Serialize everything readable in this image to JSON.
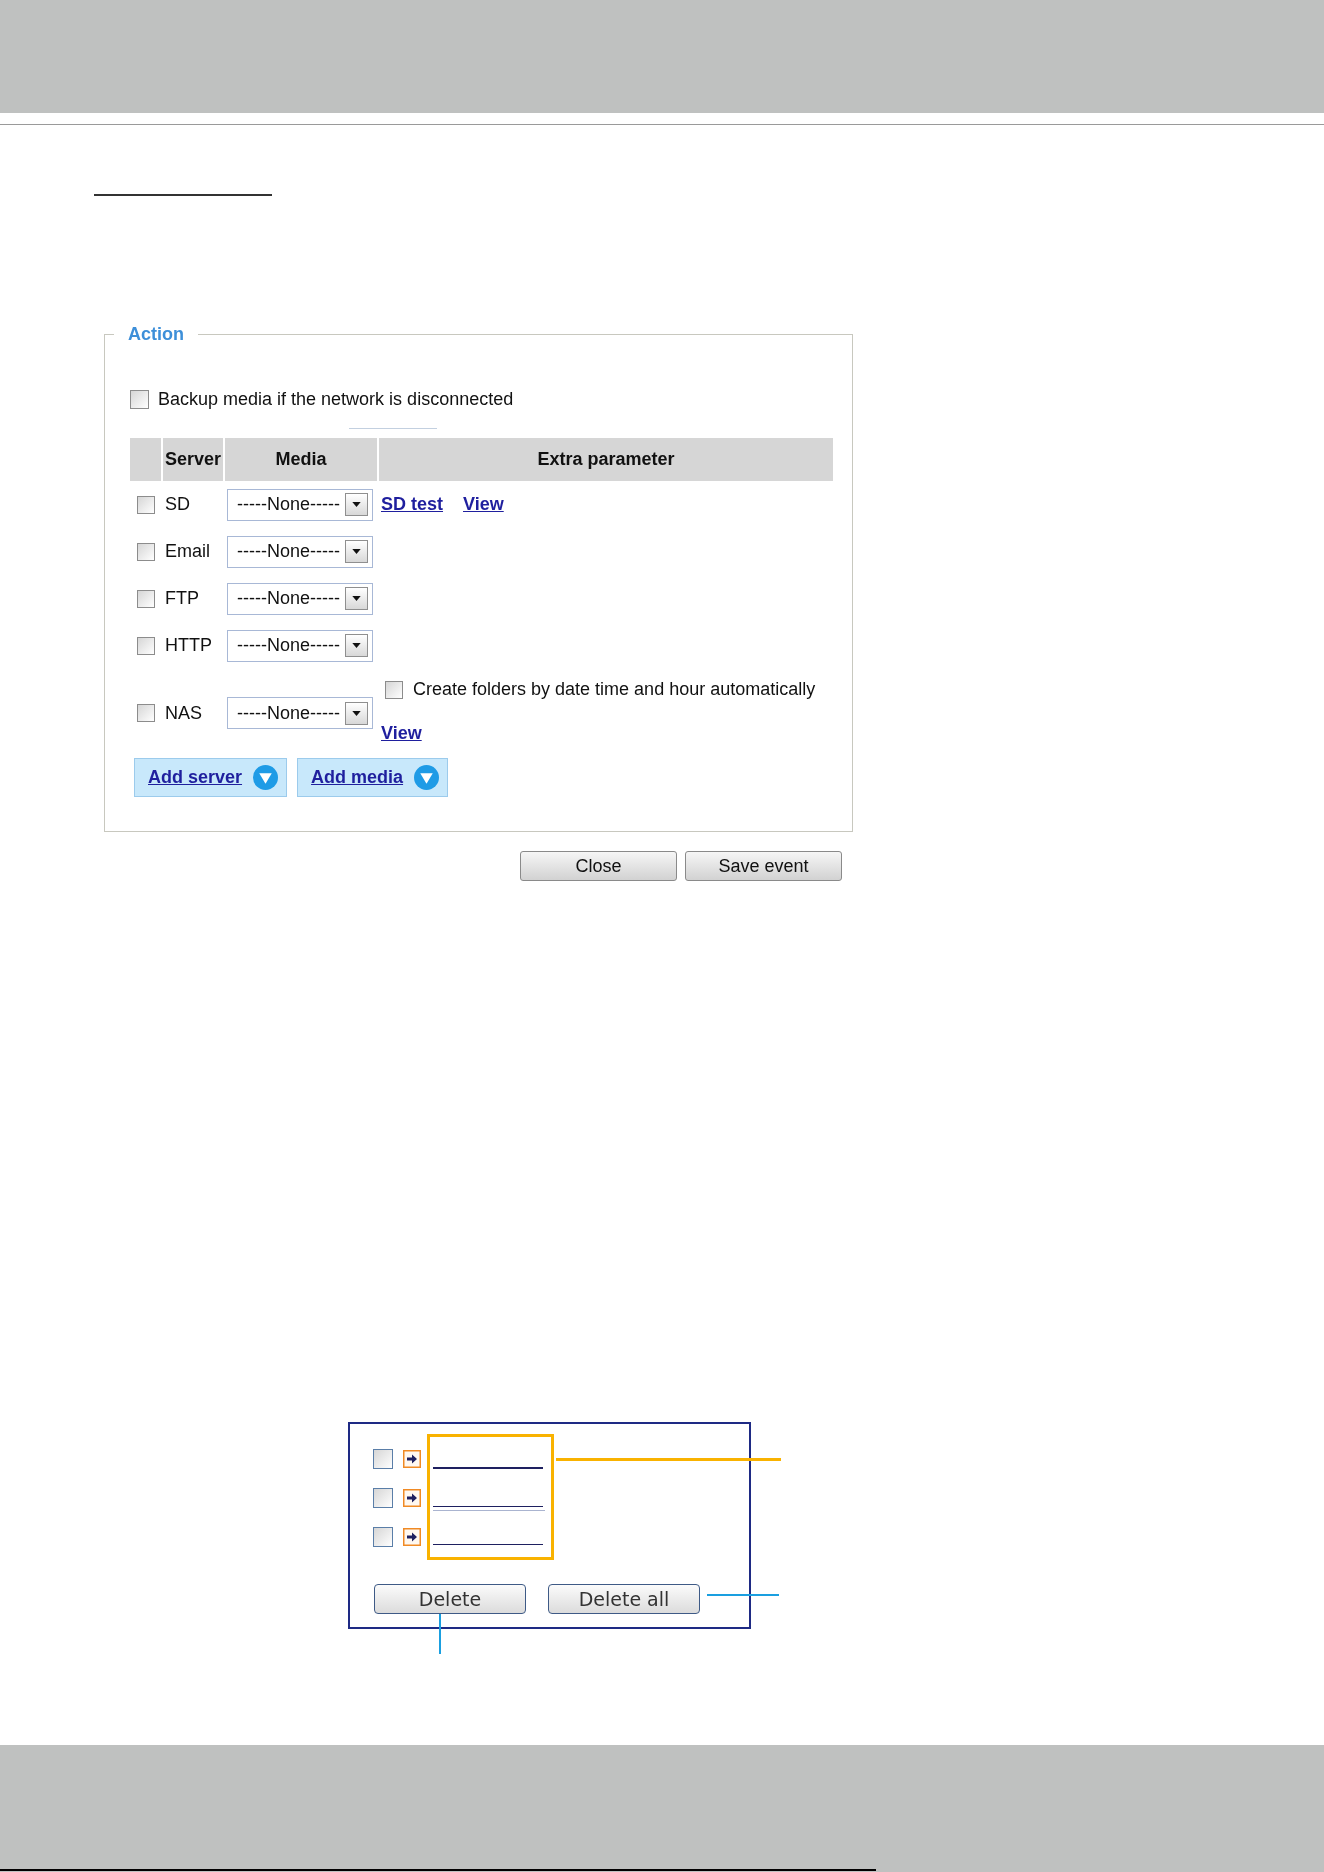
{
  "action_panel": {
    "legend": "Action",
    "backup_option": {
      "label": "Backup media if the network is disconnected",
      "checked": false
    },
    "table": {
      "columns": [
        "Server",
        "Media",
        "Extra parameter"
      ],
      "rows": [
        {
          "server": "SD",
          "checked": false,
          "media": "-----None-----",
          "extras": [
            {
              "kind": "link",
              "label": "SD test"
            },
            {
              "kind": "link",
              "label": "View"
            }
          ]
        },
        {
          "server": "Email",
          "checked": false,
          "media": "-----None-----"
        },
        {
          "server": "FTP",
          "checked": false,
          "media": "-----None-----"
        },
        {
          "server": "HTTP",
          "checked": false,
          "media": "-----None-----"
        },
        {
          "server": "NAS",
          "checked": false,
          "media": "-----None-----",
          "extras": [
            {
              "kind": "checkbox",
              "label": "Create folders by date time and hour automatically",
              "checked": false
            },
            {
              "kind": "link",
              "label": "View"
            }
          ]
        }
      ]
    },
    "add_buttons": [
      "Add server",
      "Add media"
    ]
  },
  "dialog_buttons": [
    "Close",
    "Save event"
  ],
  "event_list": {
    "items": [
      {
        "checked": false
      },
      {
        "checked": false
      },
      {
        "checked": false
      }
    ],
    "buttons": [
      "Delete",
      "Delete all"
    ]
  }
}
